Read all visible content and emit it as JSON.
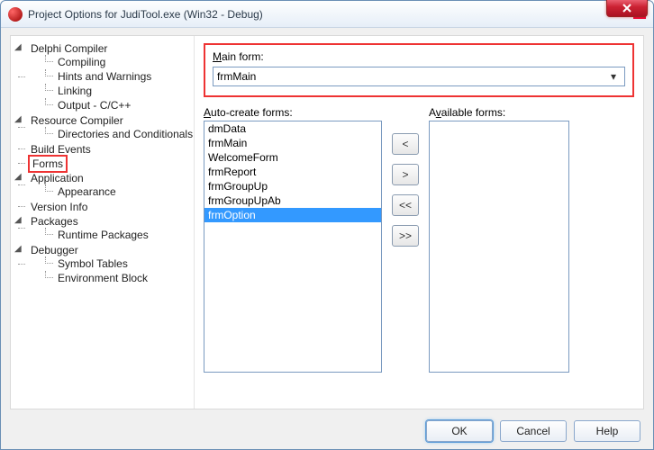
{
  "window": {
    "title": "Project Options for JudiTool.exe  (Win32 - Debug)"
  },
  "tree": {
    "delphi_compiler": "Delphi Compiler",
    "compiling": "Compiling",
    "hints_warnings": "Hints and Warnings",
    "linking": "Linking",
    "output": "Output - C/C++",
    "resource_compiler": "Resource Compiler",
    "dirs_cond": "Directories and Conditionals",
    "build_events": "Build Events",
    "forms": "Forms",
    "application": "Application",
    "appearance": "Appearance",
    "version_info": "Version Info",
    "packages": "Packages",
    "runtime_packages": "Runtime Packages",
    "debugger": "Debugger",
    "symbol_tables": "Symbol Tables",
    "environment_block": "Environment Block"
  },
  "main_form": {
    "label_prefix": "M",
    "label_rest": "ain form:",
    "value": "frmMain"
  },
  "auto_create": {
    "label_u": "A",
    "label_rest": "uto-create forms:",
    "items": [
      "dmData",
      "frmMain",
      "WelcomeForm",
      "frmReport",
      "frmGroupUp",
      "frmGroupUpAb",
      "frmOption"
    ],
    "selected_index": 6
  },
  "available": {
    "label_pre": "A",
    "label_u": "v",
    "label_rest": "ailable forms:"
  },
  "shuttle": {
    "to_left": "<",
    "to_right": ">",
    "all_left": "<<",
    "all_right": ">>"
  },
  "footer": {
    "ok": "OK",
    "cancel": "Cancel",
    "help": "Help"
  }
}
